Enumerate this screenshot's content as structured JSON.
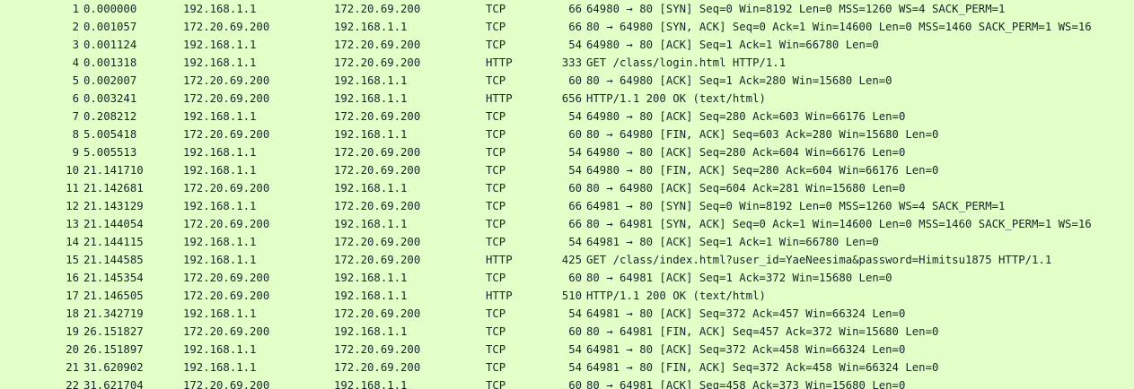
{
  "packets": [
    {
      "no": "1",
      "time": "0.000000",
      "src": "192.168.1.1",
      "dst": "172.20.69.200",
      "proto": "TCP",
      "len": "66",
      "info": "64980 → 80 [SYN] Seq=0 Win=8192 Len=0 MSS=1260 WS=4 SACK_PERM=1"
    },
    {
      "no": "2",
      "time": "0.001057",
      "src": "172.20.69.200",
      "dst": "192.168.1.1",
      "proto": "TCP",
      "len": "66",
      "info": "80 → 64980 [SYN, ACK] Seq=0 Ack=1 Win=14600 Len=0 MSS=1460 SACK_PERM=1 WS=16"
    },
    {
      "no": "3",
      "time": "0.001124",
      "src": "192.168.1.1",
      "dst": "172.20.69.200",
      "proto": "TCP",
      "len": "54",
      "info": "64980 → 80 [ACK] Seq=1 Ack=1 Win=66780 Len=0"
    },
    {
      "no": "4",
      "time": "0.001318",
      "src": "192.168.1.1",
      "dst": "172.20.69.200",
      "proto": "HTTP",
      "len": "333",
      "info": "GET /class/login.html HTTP/1.1"
    },
    {
      "no": "5",
      "time": "0.002007",
      "src": "172.20.69.200",
      "dst": "192.168.1.1",
      "proto": "TCP",
      "len": "60",
      "info": "80 → 64980 [ACK] Seq=1 Ack=280 Win=15680 Len=0"
    },
    {
      "no": "6",
      "time": "0.003241",
      "src": "172.20.69.200",
      "dst": "192.168.1.1",
      "proto": "HTTP",
      "len": "656",
      "info": "HTTP/1.1 200 OK  (text/html)"
    },
    {
      "no": "7",
      "time": "0.208212",
      "src": "192.168.1.1",
      "dst": "172.20.69.200",
      "proto": "TCP",
      "len": "54",
      "info": "64980 → 80 [ACK] Seq=280 Ack=603 Win=66176 Len=0"
    },
    {
      "no": "8",
      "time": "5.005418",
      "src": "172.20.69.200",
      "dst": "192.168.1.1",
      "proto": "TCP",
      "len": "60",
      "info": "80 → 64980 [FIN, ACK] Seq=603 Ack=280 Win=15680 Len=0"
    },
    {
      "no": "9",
      "time": "5.005513",
      "src": "192.168.1.1",
      "dst": "172.20.69.200",
      "proto": "TCP",
      "len": "54",
      "info": "64980 → 80 [ACK] Seq=280 Ack=604 Win=66176 Len=0"
    },
    {
      "no": "10",
      "time": "21.141710",
      "src": "192.168.1.1",
      "dst": "172.20.69.200",
      "proto": "TCP",
      "len": "54",
      "info": "64980 → 80 [FIN, ACK] Seq=280 Ack=604 Win=66176 Len=0"
    },
    {
      "no": "11",
      "time": "21.142681",
      "src": "172.20.69.200",
      "dst": "192.168.1.1",
      "proto": "TCP",
      "len": "60",
      "info": "80 → 64980 [ACK] Seq=604 Ack=281 Win=15680 Len=0"
    },
    {
      "no": "12",
      "time": "21.143129",
      "src": "192.168.1.1",
      "dst": "172.20.69.200",
      "proto": "TCP",
      "len": "66",
      "info": "64981 → 80 [SYN] Seq=0 Win=8192 Len=0 MSS=1260 WS=4 SACK_PERM=1"
    },
    {
      "no": "13",
      "time": "21.144054",
      "src": "172.20.69.200",
      "dst": "192.168.1.1",
      "proto": "TCP",
      "len": "66",
      "info": "80 → 64981 [SYN, ACK] Seq=0 Ack=1 Win=14600 Len=0 MSS=1460 SACK_PERM=1 WS=16"
    },
    {
      "no": "14",
      "time": "21.144115",
      "src": "192.168.1.1",
      "dst": "172.20.69.200",
      "proto": "TCP",
      "len": "54",
      "info": "64981 → 80 [ACK] Seq=1 Ack=1 Win=66780 Len=0"
    },
    {
      "no": "15",
      "time": "21.144585",
      "src": "192.168.1.1",
      "dst": "172.20.69.200",
      "proto": "HTTP",
      "len": "425",
      "info": "GET /class/index.html?user_id=YaeNeesima&password=Himitsu1875 HTTP/1.1"
    },
    {
      "no": "16",
      "time": "21.145354",
      "src": "172.20.69.200",
      "dst": "192.168.1.1",
      "proto": "TCP",
      "len": "60",
      "info": "80 → 64981 [ACK] Seq=1 Ack=372 Win=15680 Len=0"
    },
    {
      "no": "17",
      "time": "21.146505",
      "src": "172.20.69.200",
      "dst": "192.168.1.1",
      "proto": "HTTP",
      "len": "510",
      "info": "HTTP/1.1 200 OK  (text/html)"
    },
    {
      "no": "18",
      "time": "21.342719",
      "src": "192.168.1.1",
      "dst": "172.20.69.200",
      "proto": "TCP",
      "len": "54",
      "info": "64981 → 80 [ACK] Seq=372 Ack=457 Win=66324 Len=0"
    },
    {
      "no": "19",
      "time": "26.151827",
      "src": "172.20.69.200",
      "dst": "192.168.1.1",
      "proto": "TCP",
      "len": "60",
      "info": "80 → 64981 [FIN, ACK] Seq=457 Ack=372 Win=15680 Len=0"
    },
    {
      "no": "20",
      "time": "26.151897",
      "src": "192.168.1.1",
      "dst": "172.20.69.200",
      "proto": "TCP",
      "len": "54",
      "info": "64981 → 80 [ACK] Seq=372 Ack=458 Win=66324 Len=0"
    },
    {
      "no": "21",
      "time": "31.620902",
      "src": "192.168.1.1",
      "dst": "172.20.69.200",
      "proto": "TCP",
      "len": "54",
      "info": "64981 → 80 [FIN, ACK] Seq=372 Ack=458 Win=66324 Len=0"
    },
    {
      "no": "22",
      "time": "31.621704",
      "src": "172.20.69.200",
      "dst": "192.168.1.1",
      "proto": "TCP",
      "len": "60",
      "info": "80 → 64981 [ACK] Seq=458 Ack=373 Win=15680 Len=0"
    }
  ],
  "colors": {
    "row_background": "#e4ffc7",
    "text": "#12272e"
  }
}
